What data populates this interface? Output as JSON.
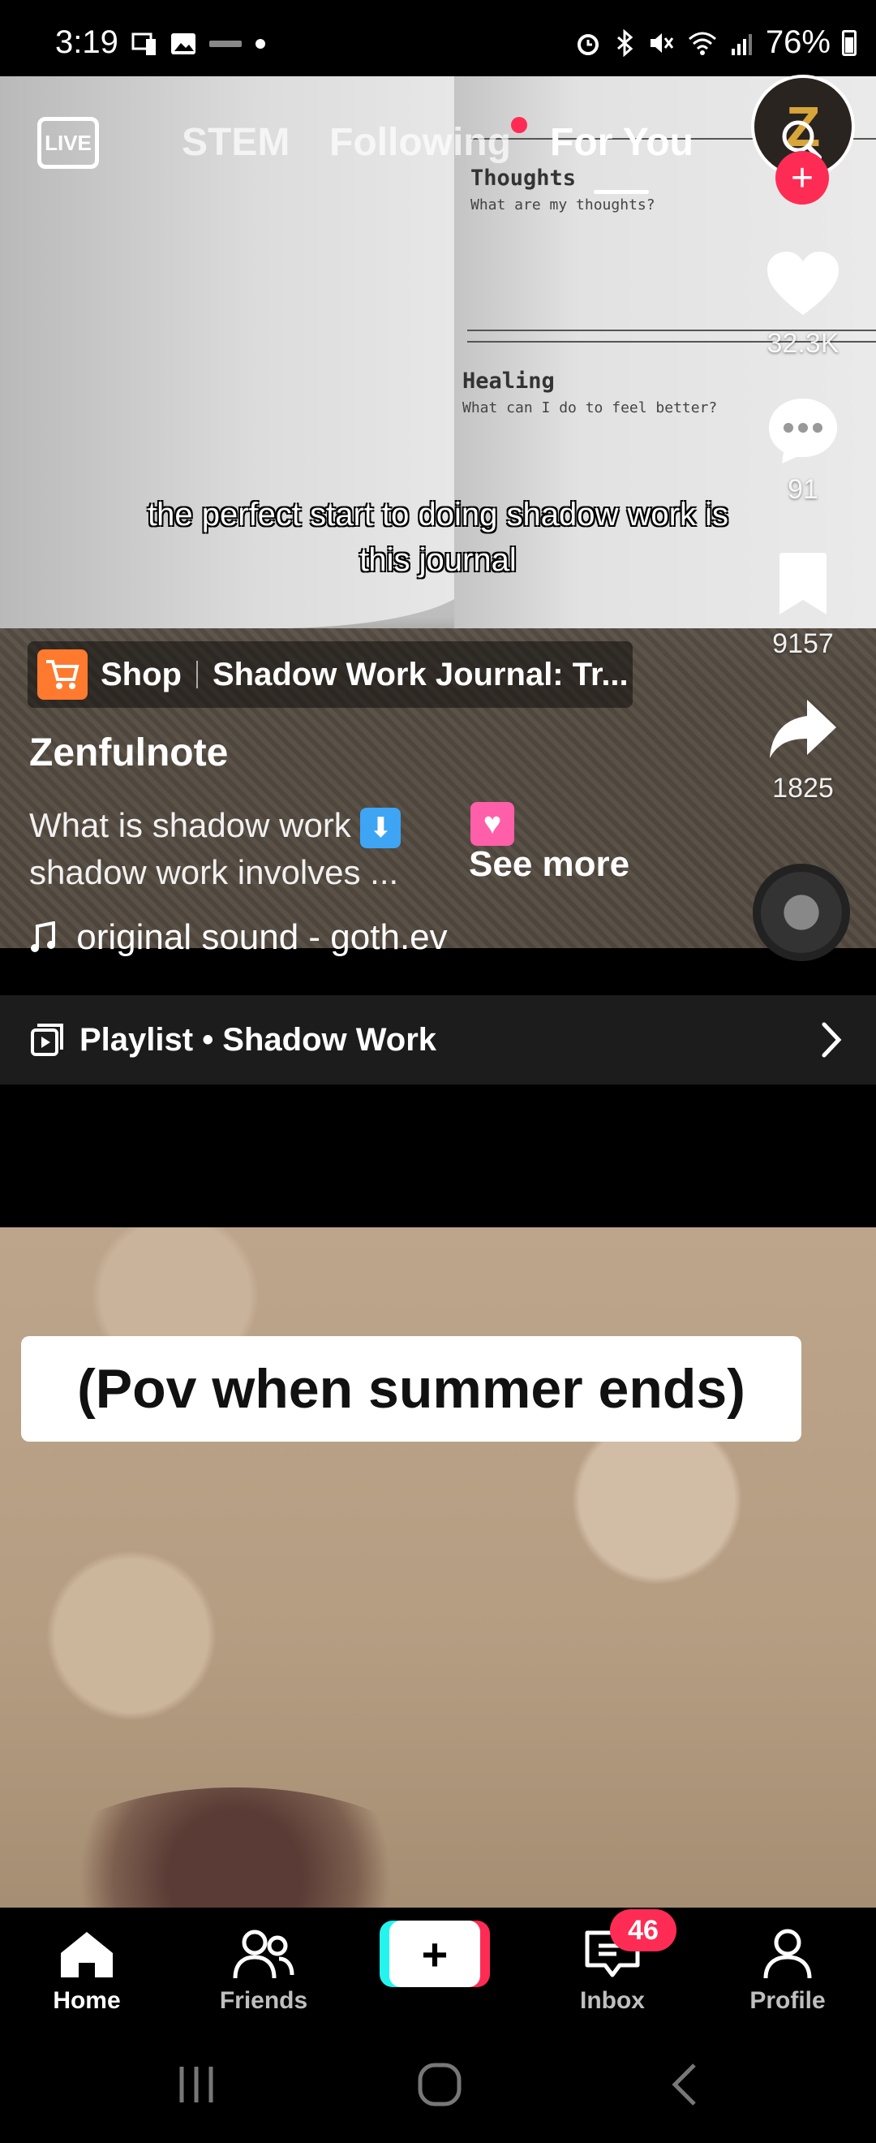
{
  "status_bar": {
    "time": "3:19",
    "battery": "76%",
    "icons": [
      "phone-screen-icon",
      "image-icon",
      "notification-dot",
      "alarm-icon",
      "bluetooth-icon",
      "mute-icon",
      "wifi-icon",
      "signal-icon",
      "battery-icon"
    ]
  },
  "top_nav": {
    "live_label": "LIVE",
    "tabs": [
      {
        "label": "STEM",
        "active": false
      },
      {
        "label": "Following",
        "active": false,
        "has_dot": true
      },
      {
        "label": "For You",
        "active": true
      }
    ]
  },
  "video1": {
    "journal": {
      "heading1": "Thoughts",
      "sub1": "What are my thoughts?",
      "heading2": "Healing",
      "sub2": "What can I do to feel better?"
    },
    "caption": "the perfect start to doing shadow work is this journal",
    "avatar_letter": "Z",
    "rail": {
      "likes": "32.3K",
      "comments": "91",
      "bookmarks": "9157",
      "shares": "1825"
    },
    "shop": {
      "label": "Shop",
      "product": "Shadow Work Journal: Tr..."
    },
    "author": "Zenfulnote",
    "description_line1": "What is shadow work",
    "description_line2": "shadow work involves ...",
    "see_more": "See more",
    "sound": "original sound - goth.ev"
  },
  "playlist": {
    "label": "Playlist • Shadow Work"
  },
  "video2": {
    "overlay_text": "(Pov when summer ends)"
  },
  "bottom_nav": {
    "items": [
      {
        "label": "Home",
        "active": true
      },
      {
        "label": "Friends",
        "active": false
      },
      {
        "label": "Inbox",
        "active": false
      },
      {
        "label": "Profile",
        "active": false
      }
    ],
    "inbox_badge": "46"
  },
  "colors": {
    "accent": "#fe2c55",
    "cyan": "#25f4ee",
    "shop_orange": "#ff7a2e"
  }
}
